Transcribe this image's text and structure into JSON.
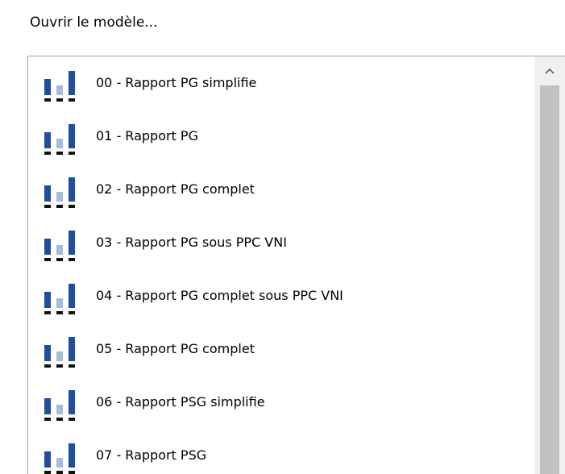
{
  "dialog": {
    "label": "Ouvrir le modèle..."
  },
  "icon_name": "bar-chart-report-icon",
  "colors": {
    "icon_dark_blue": "#1f4e9c",
    "icon_light_blue": "#a7bcd8",
    "scroll_thumb": "#c1c1c1",
    "scroll_track": "#f0f0f0"
  },
  "template_list": {
    "items": [
      {
        "label": "00 - Rapport PG simplifie"
      },
      {
        "label": "01 - Rapport PG"
      },
      {
        "label": "02 - Rapport PG complet"
      },
      {
        "label": "03 - Rapport PG sous PPC VNI"
      },
      {
        "label": "04 - Rapport PG complet sous PPC VNI"
      },
      {
        "label": "05 - Rapport PG complet"
      },
      {
        "label": "06 - Rapport PSG simplifie"
      },
      {
        "label": "07 - Rapport PSG"
      }
    ]
  },
  "scrollbar": {
    "up_arrow_icon": "chevron-up-icon"
  }
}
